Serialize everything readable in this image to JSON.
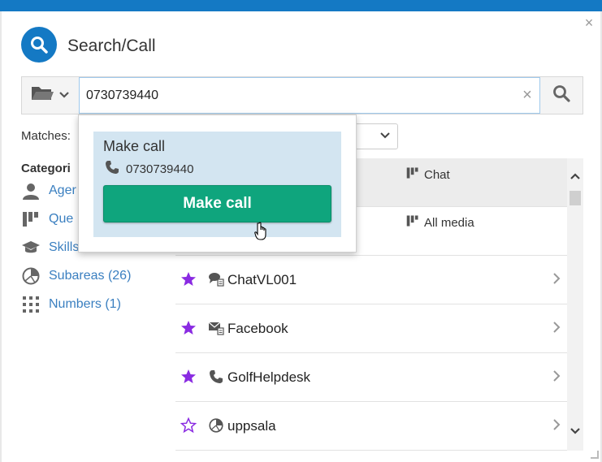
{
  "header": {
    "title": "Search/Call"
  },
  "search": {
    "value": "0730739440",
    "placeholder": ""
  },
  "matches_label": "Matches:",
  "categories": {
    "title": "Categori",
    "items": [
      {
        "label": "Ager",
        "icon": "person-icon"
      },
      {
        "label": "Que",
        "icon": "queue-icon"
      },
      {
        "label": "Skills",
        "icon": "graduation-cap-icon"
      },
      {
        "label": "Subareas (26)",
        "icon": "pie-chart-icon"
      },
      {
        "label": "Numbers (1)",
        "icon": "grid-dots-icon"
      }
    ]
  },
  "list": {
    "items": [
      {
        "name": "",
        "media": "Chat",
        "starred": null,
        "icon": ""
      },
      {
        "name": "",
        "media": "All media",
        "starred": null,
        "icon": ""
      },
      {
        "name": "ChatVL001",
        "media": "",
        "starred": true,
        "icon": "chat-bubbles-icon"
      },
      {
        "name": "Facebook",
        "media": "",
        "starred": true,
        "icon": "email-icon"
      },
      {
        "name": "GolfHelpdesk",
        "media": "",
        "starred": true,
        "icon": "phone-icon"
      },
      {
        "name": "uppsala",
        "media": "",
        "starred": false,
        "icon": "pie-chart-icon"
      }
    ]
  },
  "popup": {
    "title": "Make call",
    "number": "0730739440",
    "button_label": "Make call"
  },
  "colors": {
    "brand": "#1479c4",
    "button_green": "#0fa57d",
    "star_purple": "#8a2be2",
    "link_blue": "#3a7fc0"
  }
}
